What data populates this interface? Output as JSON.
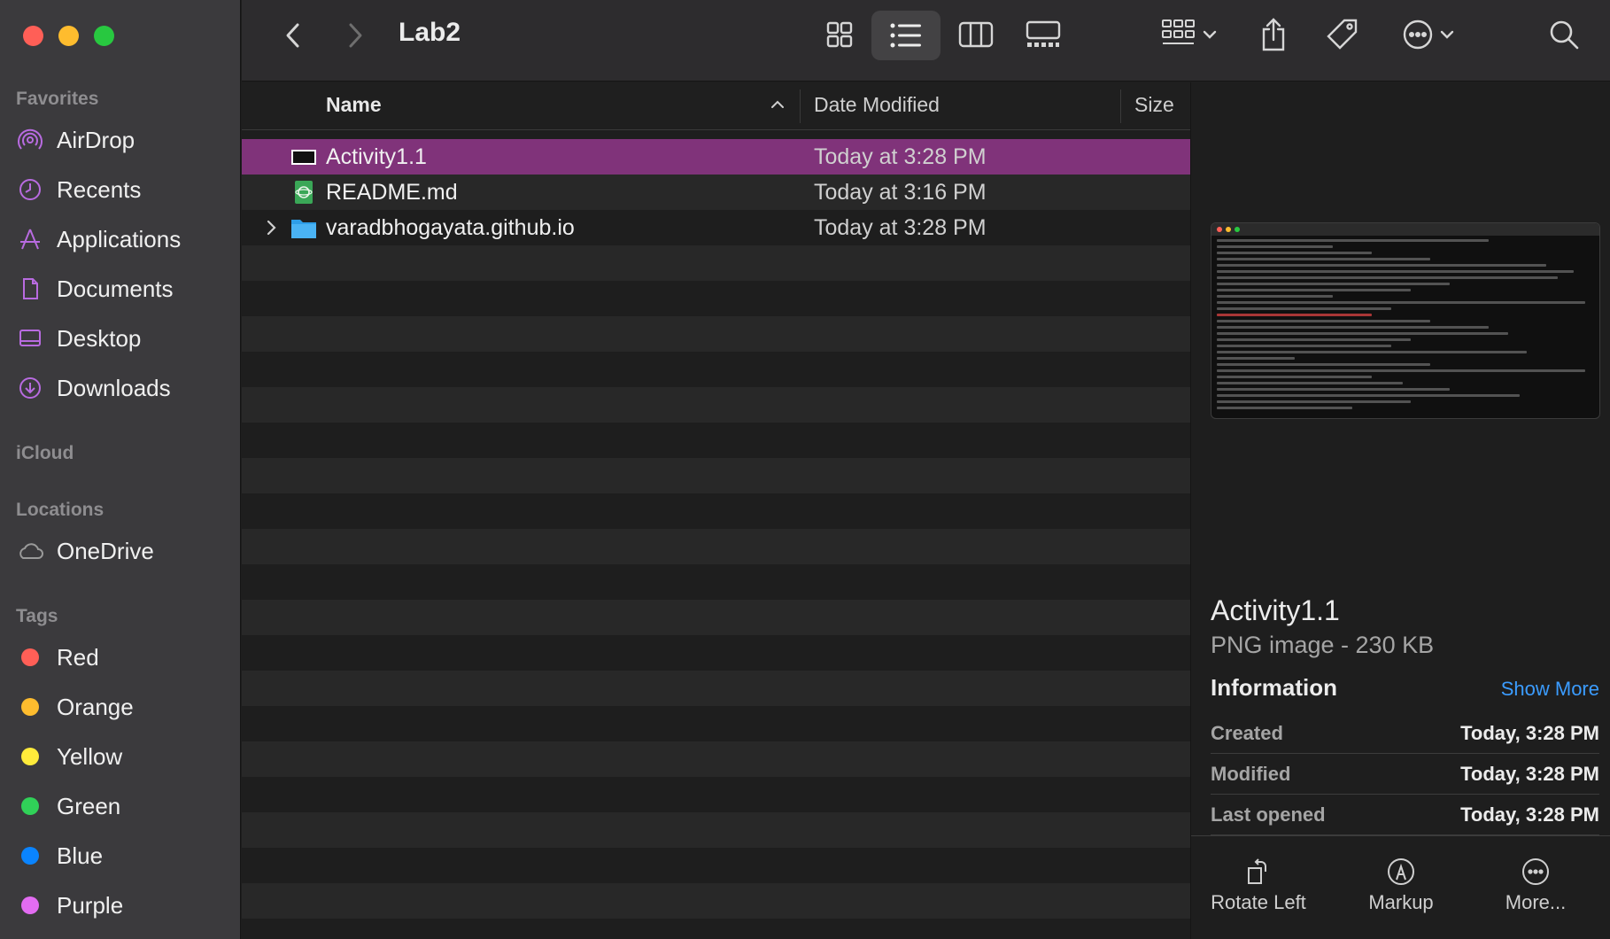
{
  "sidebar": {
    "favorites_title": "Favorites",
    "favorites": [
      {
        "label": "AirDrop",
        "icon": "airdrop-icon"
      },
      {
        "label": "Recents",
        "icon": "clock-icon"
      },
      {
        "label": "Applications",
        "icon": "applications-icon"
      },
      {
        "label": "Documents",
        "icon": "document-icon"
      },
      {
        "label": "Desktop",
        "icon": "desktop-icon"
      },
      {
        "label": "Downloads",
        "icon": "download-icon"
      }
    ],
    "icloud_title": "iCloud",
    "locations_title": "Locations",
    "locations": [
      {
        "label": "OneDrive",
        "icon": "cloud-icon"
      }
    ],
    "tags_title": "Tags",
    "tags": [
      {
        "label": "Red",
        "color": "#ff5f57"
      },
      {
        "label": "Orange",
        "color": "#febc2e"
      },
      {
        "label": "Yellow",
        "color": "#ffeb3b"
      },
      {
        "label": "Green",
        "color": "#30d158"
      },
      {
        "label": "Blue",
        "color": "#0a84ff"
      },
      {
        "label": "Purple",
        "color": "#e36cf2"
      }
    ]
  },
  "toolbar": {
    "title": "Lab2",
    "accent": "#a566e0"
  },
  "list": {
    "columns": {
      "name": "Name",
      "date": "Date Modified",
      "size": "Size"
    },
    "rows": [
      {
        "name": "Activity1.1",
        "date": "Today at 3:28 PM",
        "icon": "image-file-icon",
        "selected": true
      },
      {
        "name": "README.md",
        "date": "Today at 3:16 PM",
        "icon": "markdown-file-icon",
        "selected": false
      },
      {
        "name": "varadbhogayata.github.io",
        "date": "Today at 3:28 PM",
        "icon": "folder-icon",
        "selected": false
      }
    ],
    "selection_color": "#80337a"
  },
  "preview": {
    "name": "Activity1.1",
    "kind": "PNG image - 230 KB",
    "info_title": "Information",
    "show_more": "Show More",
    "info": [
      {
        "key": "Created",
        "value": "Today, 3:28 PM"
      },
      {
        "key": "Modified",
        "value": "Today, 3:28 PM"
      },
      {
        "key": "Last opened",
        "value": "Today, 3:28 PM"
      }
    ],
    "actions": [
      {
        "label": "Rotate Left",
        "icon": "rotate-left-icon"
      },
      {
        "label": "Markup",
        "icon": "markup-icon"
      },
      {
        "label": "More...",
        "icon": "more-icon"
      }
    ]
  }
}
